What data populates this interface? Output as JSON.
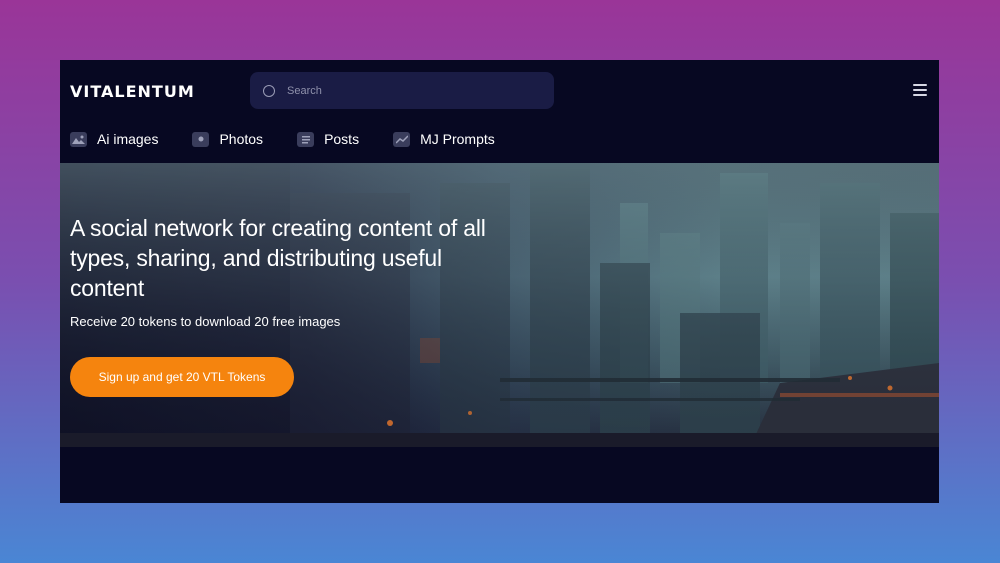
{
  "header": {
    "logo": "VITALENTUM",
    "search": {
      "placeholder": "Search"
    }
  },
  "nav": {
    "items": [
      {
        "label": "Ai images",
        "icon": "image-icon"
      },
      {
        "label": "Photos",
        "icon": "camera-icon"
      },
      {
        "label": "Posts",
        "icon": "document-icon"
      },
      {
        "label": "MJ Prompts",
        "icon": "trend-icon"
      }
    ]
  },
  "hero": {
    "title": "A social network for creating content of all types, sharing, and distributing useful content",
    "subtitle": "Receive 20 tokens to download 20 free images",
    "cta_label": "Sign up and get 20 VTL Tokens"
  },
  "colors": {
    "background": "#070822",
    "accent": "#f5840e",
    "search_bg": "#1a1c45"
  }
}
